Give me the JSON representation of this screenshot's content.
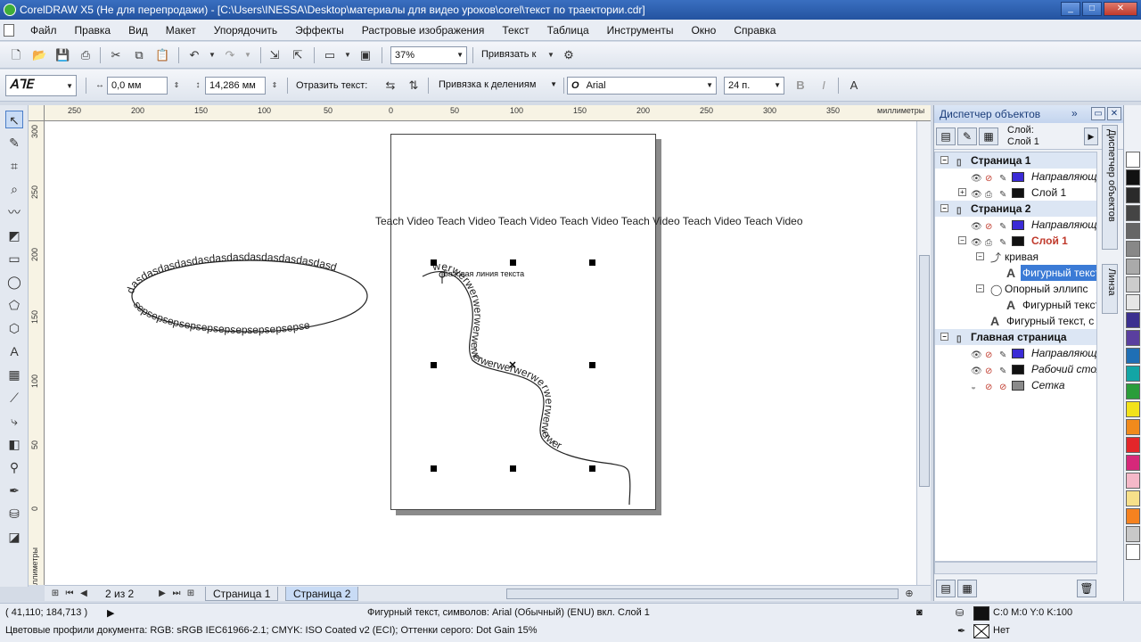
{
  "window": {
    "title": "CorelDRAW X5 (Не для перепродажи) - [C:\\Users\\INESSA\\Desktop\\материалы для видео уроков\\corel\\текст по траектории.cdr]",
    "controls": [
      "_",
      "□",
      "✕"
    ]
  },
  "menu": [
    "Файл",
    "Правка",
    "Вид",
    "Макет",
    "Упорядочить",
    "Эффекты",
    "Растровые изображения",
    "Текст",
    "Таблица",
    "Инструменты",
    "Окно",
    "Справка"
  ],
  "toolbar": {
    "zoom": "37%",
    "snap_label": "Привязать к"
  },
  "property_bar": {
    "offset_x": "0,0 мм",
    "offset_y": "14,286 мм",
    "mirror_label": "Отразить текст:",
    "snap_marks": "Привязка к делениям",
    "font": "Arial",
    "font_size": "24 п."
  },
  "rulers": {
    "top_labels": [
      "250",
      "200",
      "150",
      "100",
      "50",
      "0",
      "50",
      "100",
      "150",
      "200",
      "250",
      "300",
      "350"
    ],
    "unit": "миллиметры",
    "left_labels": [
      "300",
      "250",
      "200",
      "150",
      "100",
      "50",
      "0"
    ],
    "left_unit": "миллиметры"
  },
  "canvas": {
    "teach_text": "Teach Video Teach Video Teach Video Teach Video Teach Video Teach Video Teach Video",
    "ellipse_text_top": "dasdasdasdasdasdasdasdasdasdasdasdasd",
    "ellipse_text_bottom": "sepsepsepsepsepsepsepsepsepsepse",
    "curve_text": "werwerwerwerwerwerwerwerwerwerwerwerwerwerwer",
    "tooltip": "Базовая линия текста"
  },
  "pages": {
    "counter": "2 из 2",
    "tabs": [
      "Страница 1",
      "Страница 2"
    ],
    "active": 1
  },
  "status": {
    "coords": "( 41,110; 184,713 )",
    "info": "Фигурный текст, символов: Arial (Обычный) (ENU) вкл. Слой 1",
    "color_profiles": "Цветовые профили документа: RGB: sRGB IEC61966-2.1; CMYK: ISO Coated v2 (ECI); Оттенки серого: Dot Gain 15%",
    "fill": "C:0 M:0 Y:0 K:100",
    "outline": "Нет"
  },
  "docker": {
    "title": "Диспетчер объектов",
    "layer_label": "Слой:",
    "layer_name": "Слой 1",
    "tree": [
      {
        "label": "Страница 1",
        "type": "page"
      },
      {
        "label": "Направляющие",
        "type": "layer",
        "italic": true,
        "color": "#3b2bd6"
      },
      {
        "label": "Слой 1",
        "type": "layer",
        "color": "#111111"
      },
      {
        "label": "Страница 2",
        "type": "page"
      },
      {
        "label": "Направляющие",
        "type": "layer",
        "italic": true,
        "color": "#3b2bd6"
      },
      {
        "label": "Слой 1",
        "type": "layer",
        "color": "#111111",
        "selected": true
      },
      {
        "label": "кривая",
        "type": "object"
      },
      {
        "label": "Фигурный текст",
        "type": "text",
        "highlight": true
      },
      {
        "label": "Опорный эллипс",
        "type": "object"
      },
      {
        "label": "Фигурный текст",
        "type": "text"
      },
      {
        "label": "Фигурный текст, с",
        "type": "text"
      },
      {
        "label": "Главная страница",
        "type": "page"
      },
      {
        "label": "Направляющие",
        "type": "layer",
        "italic": true,
        "color": "#3b2bd6"
      },
      {
        "label": "Рабочий стол",
        "type": "layer",
        "italic": true,
        "color": "#111111"
      },
      {
        "label": "Сетка",
        "type": "layer",
        "italic": true,
        "color": "#8a8a8a"
      }
    ],
    "side_tabs": [
      "Диспетчер объектов",
      "Линза"
    ]
  },
  "palette": [
    "#ffffff",
    "#111111",
    "#2a2a2a",
    "#444444",
    "#666666",
    "#888888",
    "#aaaaaa",
    "#cccccc",
    "#e6e6e6",
    "#3a2f8f",
    "#5a3f9f",
    "#1f6fb5",
    "#13a5a5",
    "#2a9d3a",
    "#f2e21a",
    "#f08a1c",
    "#e3262a",
    "#d6287a",
    "#f5b8c8",
    "#f7e08a",
    "#f58220",
    "#c8c8c8",
    "#ffffff"
  ]
}
